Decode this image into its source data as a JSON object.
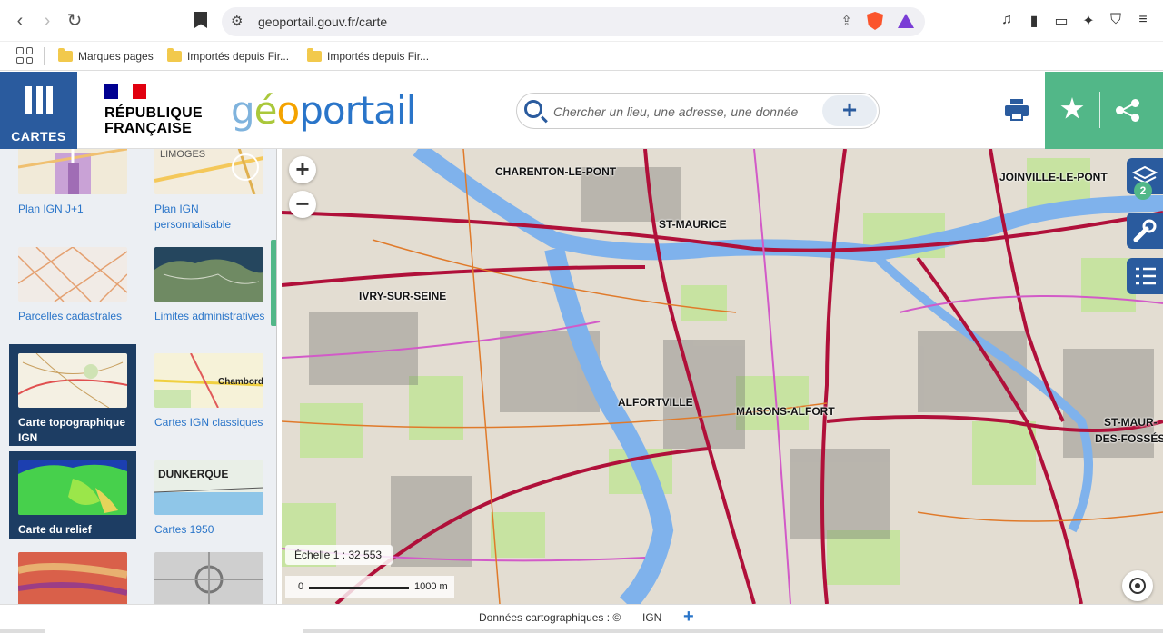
{
  "browser": {
    "url": "geoportail.gouv.fr/carte",
    "bookmarks": [
      "Marques pages",
      "Importés depuis Fir...",
      "Importés depuis Fir..."
    ]
  },
  "header": {
    "menu_label": "CARTES",
    "rf_line1": "RÉPUBLIQUE",
    "rf_line2": "FRANÇAISE",
    "logo_geo": "géo",
    "logo_portail": "portail",
    "search_placeholder": "Chercher un lieu, une adresse, une donnée",
    "search_plus": "+"
  },
  "sidebar": {
    "tiles": [
      {
        "label": "Plan IGN J+1",
        "selected": false
      },
      {
        "label": "Plan IGN personnalisable",
        "selected": false
      },
      {
        "label": "Parcelles cadastrales",
        "selected": false
      },
      {
        "label": "Limites administratives",
        "selected": false
      },
      {
        "label": "Carte topographique IGN",
        "selected": true
      },
      {
        "label": "Cartes IGN classiques",
        "selected": false
      },
      {
        "label": "Carte du relief",
        "selected": true
      },
      {
        "label": "Cartes 1950",
        "selected": false
      }
    ],
    "thumb_texts": {
      "limoges": "LIMOGES",
      "chambord": "Chambord",
      "dunkerque": "DUNKERQUE"
    }
  },
  "map": {
    "labels": [
      "CHARENTON-LE-PONT",
      "ST-MAURICE",
      "IVRY-SUR-SEINE",
      "ALFORTVILLE",
      "MAISONS-ALFORT",
      "JOINVILLE-LE-PONT",
      "ST-MAUR-",
      "DES-FOSSÉS"
    ],
    "layers_badge": "2",
    "scale_text": "Échelle 1 : 32 553",
    "scale_zero": "0",
    "scale_km": "1000 m",
    "zoom_in": "+",
    "zoom_out": "−"
  },
  "footer": {
    "credits": "Données cartographiques : ©",
    "provider": "IGN",
    "more": "+"
  }
}
